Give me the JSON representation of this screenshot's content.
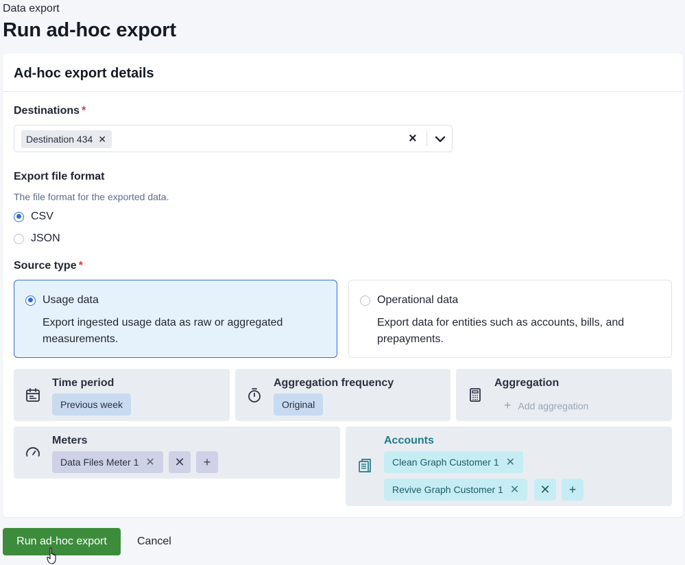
{
  "breadcrumb": "Data export",
  "title": "Run ad-hoc export",
  "card": {
    "title": "Ad-hoc export details"
  },
  "destinations": {
    "label": "Destinations",
    "required_mark": "*",
    "selected": [
      "Destination 434"
    ]
  },
  "file_format": {
    "label": "Export file format",
    "help": "The file format for the exported data.",
    "options": [
      {
        "label": "CSV",
        "selected": true
      },
      {
        "label": "JSON",
        "selected": false
      }
    ]
  },
  "source_type": {
    "label": "Source type",
    "required_mark": "*",
    "options": [
      {
        "title": "Usage data",
        "description": "Export ingested usage data as raw or aggregated measurements.",
        "selected": true
      },
      {
        "title": "Operational data",
        "description": "Export data for entities such as accounts, bills, and prepayments.",
        "selected": false
      }
    ]
  },
  "criteria": {
    "time_period": {
      "label": "Time period",
      "value": "Previous week"
    },
    "aggregation_frequency": {
      "label": "Aggregation frequency",
      "value": "Original"
    },
    "aggregation": {
      "label": "Aggregation",
      "add_label": "Add aggregation"
    },
    "meters": {
      "label": "Meters",
      "items": [
        "Data Files Meter 1"
      ]
    },
    "accounts": {
      "label": "Accounts",
      "items": [
        "Clean Graph Customer 1",
        "Revive Graph Customer 1"
      ]
    }
  },
  "actions": {
    "primary": "Run ad-hoc export",
    "cancel": "Cancel"
  },
  "colors": {
    "primary_button": "#3d8c3b",
    "selected_accent": "#2f6fd6",
    "required": "#d9363e",
    "accounts_label": "#1f7a8c"
  }
}
